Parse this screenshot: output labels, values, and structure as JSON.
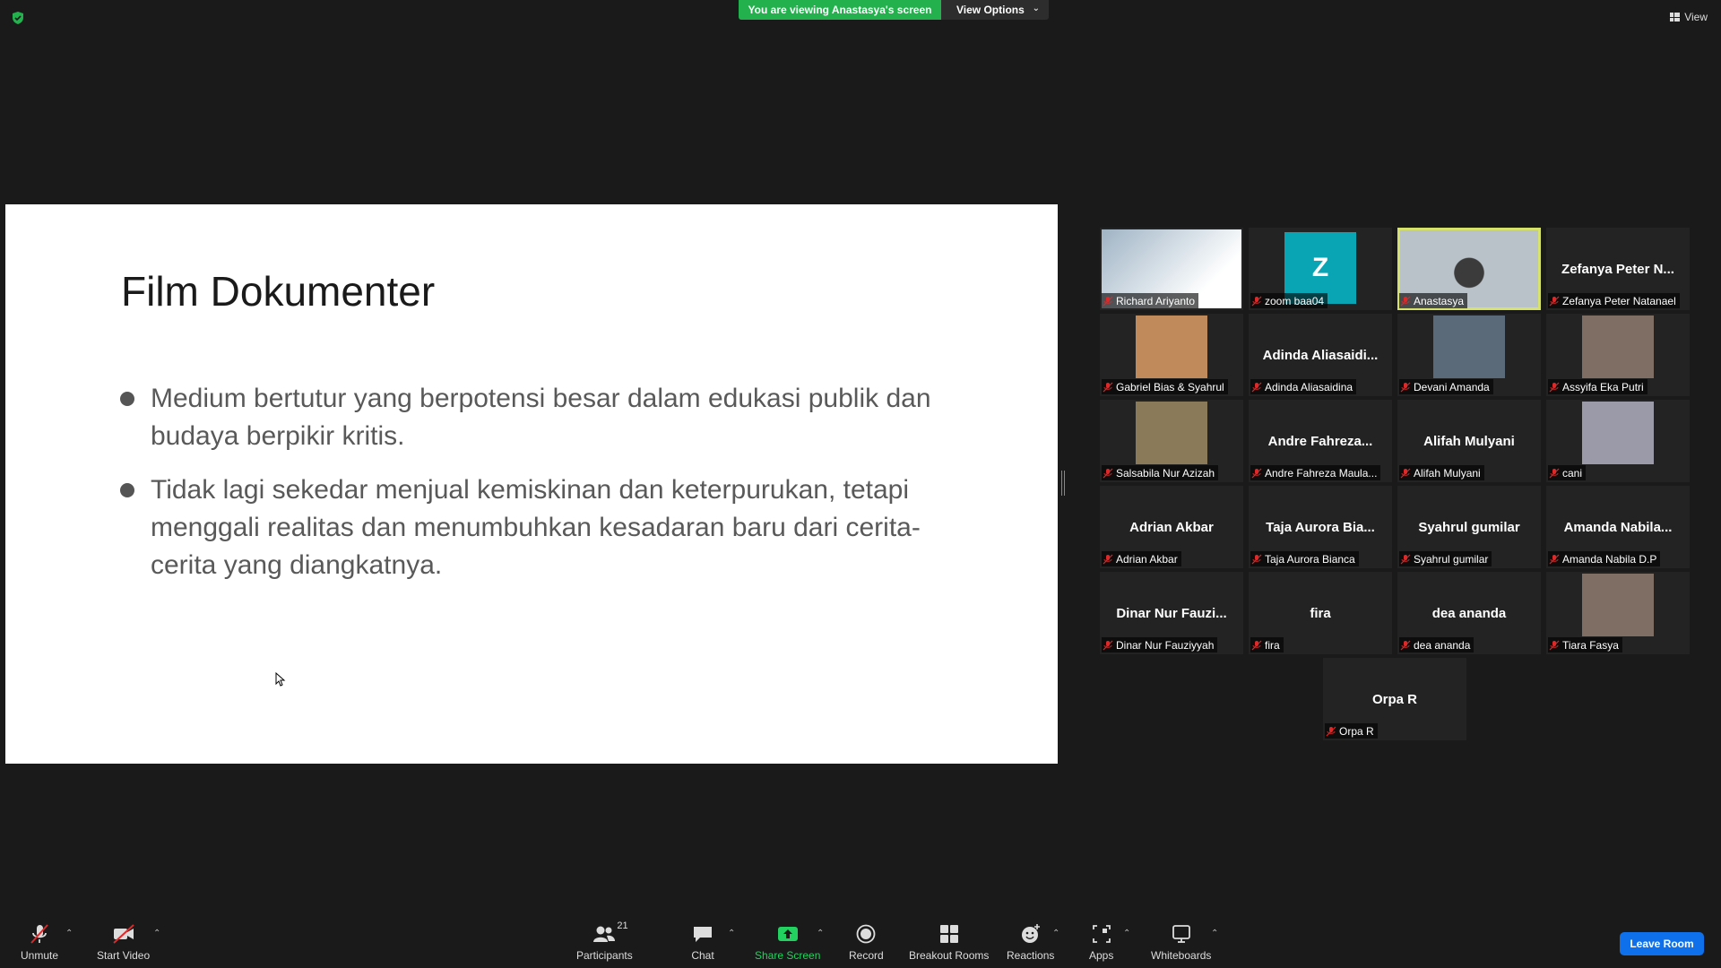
{
  "banner": {
    "viewing_text": "You are viewing Anastasya's screen",
    "view_options_label": "View Options",
    "view_label": "View"
  },
  "slide": {
    "title": "Film Dokumenter",
    "bullets": [
      "Medium bertutur yang berpotensi besar dalam edukasi publik dan budaya berpikir kritis.",
      "Tidak lagi sekedar menjual kemiskinan dan keterpurukan, tetapi menggali realitas dan menumbuhkan kesadaran baru dari cerita-cerita yang diangkatnya."
    ]
  },
  "participants": [
    {
      "name": "Richard Ariyanto",
      "display": "",
      "type": "screen"
    },
    {
      "name": "zoom baa04",
      "display": "Z",
      "type": "avatar"
    },
    {
      "name": "Anastasya",
      "display": "",
      "type": "video",
      "active": true
    },
    {
      "name": "Zefanya Peter Natanael",
      "display": "Zefanya Peter N...",
      "type": "name"
    },
    {
      "name": "Gabriel Bias & Syahrul",
      "display": "",
      "type": "photo"
    },
    {
      "name": "Adinda Aliasaidina",
      "display": "Adinda  Aliasaidi...",
      "type": "name"
    },
    {
      "name": "Devani Amanda",
      "display": "",
      "type": "photo"
    },
    {
      "name": "Assyifa Eka Putri",
      "display": "",
      "type": "photo"
    },
    {
      "name": "Salsabila Nur Azizah",
      "display": "",
      "type": "photo"
    },
    {
      "name": "Andre Fahreza Maula...",
      "display": "Andre  Fahreza...",
      "type": "name"
    },
    {
      "name": "Alifah Mulyani",
      "display": "Alifah Mulyani",
      "type": "name"
    },
    {
      "name": "cani",
      "display": "",
      "type": "photo"
    },
    {
      "name": "Adrian Akbar",
      "display": "Adrian Akbar",
      "type": "name"
    },
    {
      "name": "Taja Aurora Bianca",
      "display": "Taja Aurora Bia...",
      "type": "name"
    },
    {
      "name": "Syahrul gumilar",
      "display": "Syahrul gumilar",
      "type": "name"
    },
    {
      "name": "Amanda Nabila D.P",
      "display": "Amanda  Nabila...",
      "type": "name"
    },
    {
      "name": "Dinar Nur Fauziyyah",
      "display": "Dinar Nur Fauzi...",
      "type": "name"
    },
    {
      "name": "fira",
      "display": "fira",
      "type": "name"
    },
    {
      "name": "dea ananda",
      "display": "dea ananda",
      "type": "name"
    },
    {
      "name": "Tiara Fasya",
      "display": "",
      "type": "photo"
    },
    {
      "name": "Orpa R",
      "display": "Orpa R",
      "type": "name"
    }
  ],
  "toolbar": {
    "unmute": "Unmute",
    "start_video": "Start Video",
    "participants": "Participants",
    "participants_count": "21",
    "chat": "Chat",
    "share_screen": "Share Screen",
    "record": "Record",
    "breakout_rooms": "Breakout Rooms",
    "reactions": "Reactions",
    "apps": "Apps",
    "whiteboards": "Whiteboards",
    "leave_room": "Leave Room"
  },
  "colors": {
    "accent_green": "#23b14d",
    "leave_blue": "#0e71eb",
    "active_speaker": "#d6e26b",
    "avatar_teal": "#0aa5b5"
  }
}
